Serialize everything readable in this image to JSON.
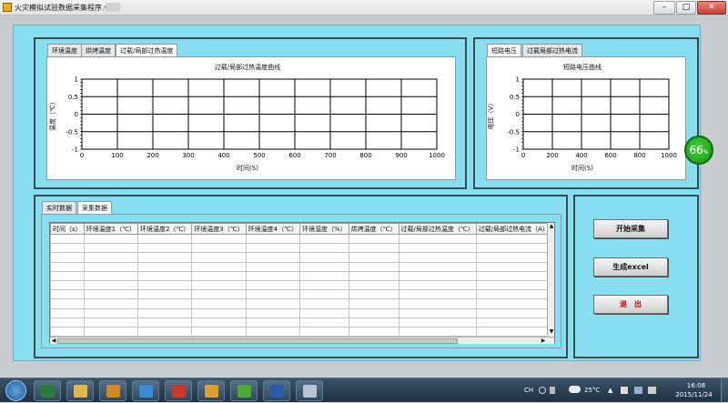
{
  "window": {
    "title": "火灾模拟试验数据采集程序.vi",
    "min_glyph": "–",
    "max_glyph": "□",
    "close_glyph": "✕"
  },
  "left_chart_panel": {
    "tabs": [
      "环境温度",
      "烘烤温度",
      "过载/局部过热温度"
    ],
    "selected_tab": 2,
    "chart_title": "过载/局部过热温度曲线",
    "ylabel": "温度（℃）",
    "xlabel": "时间(S)"
  },
  "right_chart_panel": {
    "tabs": [
      "短路电压",
      "过载局部过热电流"
    ],
    "selected_tab": 0,
    "chart_title": "短路电压曲线",
    "ylabel": "电压（V）",
    "xlabel": "时间(S)"
  },
  "chart_data": [
    {
      "type": "line",
      "title": "过载/局部过热温度曲线",
      "xlabel": "时间(S)",
      "ylabel": "温度（℃）",
      "xlim": [
        0,
        1000
      ],
      "ylim": [
        -1,
        1
      ],
      "x_ticks": [
        0,
        100,
        200,
        300,
        400,
        500,
        600,
        700,
        800,
        900,
        1000
      ],
      "y_ticks": [
        "1",
        "0.5",
        "0",
        "-0.5",
        "-1"
      ],
      "grid": true,
      "series": []
    },
    {
      "type": "line",
      "title": "短路电压曲线",
      "xlabel": "时间(S)",
      "ylabel": "电压（V）",
      "xlim": [
        0,
        1000
      ],
      "ylim": [
        -1,
        1
      ],
      "x_ticks": [
        0,
        200,
        400,
        600,
        800,
        1000
      ],
      "y_ticks": [
        "1",
        "0.5",
        "0",
        "-0.5",
        "-1"
      ],
      "grid": true,
      "series": []
    }
  ],
  "data_panel": {
    "tabs": [
      "实时数据",
      "采集数据"
    ],
    "selected_tab": 1,
    "columns": [
      "时间（s）",
      "环境温度1（℃）",
      "环境温度2（℃）",
      "环境温度3（℃）",
      "环境温度4（℃）",
      "环境湿度（%）",
      "烘烤温度（℃）",
      "过载/局部过热温度（℃）",
      "过载/局部过热电流（A）"
    ],
    "row_count": 11
  },
  "controls": {
    "start_label": "开始采集",
    "excel_label": "生成excel",
    "exit_label": "退　出",
    "exit_color": "#cc0000"
  },
  "badge": {
    "value": "66",
    "unit": "%"
  },
  "taskbar": {
    "apps": [
      "start-orb",
      "media-center",
      "file-explorer",
      "video-player",
      "internet-explorer",
      "office-app",
      "paint-app",
      "green-app",
      "word",
      "paint-brush"
    ],
    "lang": "CH",
    "weather_temp": "25°C",
    "time": "16:08",
    "date": "2015/11/24"
  },
  "colors": {
    "panel_bg": "#87def0",
    "frame_border": "#3c4a52",
    "grid": "#000000"
  }
}
